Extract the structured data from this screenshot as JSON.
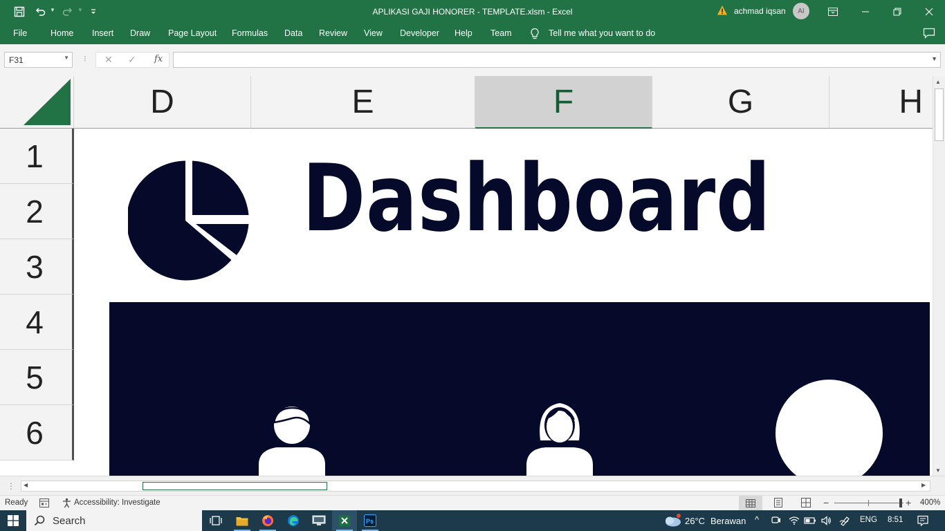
{
  "window": {
    "title": "APLIKASI GAJI HONORER - TEMPLATE.xlsm  -  Excel",
    "user_name": "achmad iqsan",
    "user_initials": "AI"
  },
  "quick_access": {
    "save": "save-icon",
    "undo": "undo-icon",
    "redo": "redo-icon",
    "customize": "customize-icon"
  },
  "ribbon": {
    "tabs": [
      "File",
      "Home",
      "Insert",
      "Draw",
      "Page Layout",
      "Formulas",
      "Data",
      "Review",
      "View",
      "Developer",
      "Help",
      "Team"
    ],
    "tell_me": "Tell me what you want to do"
  },
  "formula_bar": {
    "name_box": "F31",
    "separator": "⁝",
    "cancel": "✕",
    "enter": "✓",
    "fx": "fx",
    "formula": ""
  },
  "grid": {
    "columns": [
      "D",
      "E",
      "F",
      "G",
      "H"
    ],
    "selected_column": "F",
    "rows": [
      "1",
      "2",
      "3",
      "4",
      "5",
      "6"
    ]
  },
  "sheet": {
    "dashboard_title": "Dashboard",
    "title_color": "#060a2a",
    "panel_color": "#060a2a"
  },
  "status": {
    "ready": "Ready",
    "accessibility": "Accessibility: Investigate",
    "zoom": "400%",
    "zoom_fraction": 1.0
  },
  "taskbar": {
    "search": "Search",
    "weather_temp": "26°C",
    "weather_desc": "Berawan",
    "language": "ENG",
    "time": "8:51",
    "apps": [
      "task-view-icon",
      "file-explorer-icon",
      "firefox-icon",
      "edge-icon",
      "remote-desktop-icon",
      "excel-icon",
      "photoshop-icon"
    ]
  },
  "colors": {
    "excel_green": "#217346",
    "taskbar": "#1c3a4a"
  }
}
